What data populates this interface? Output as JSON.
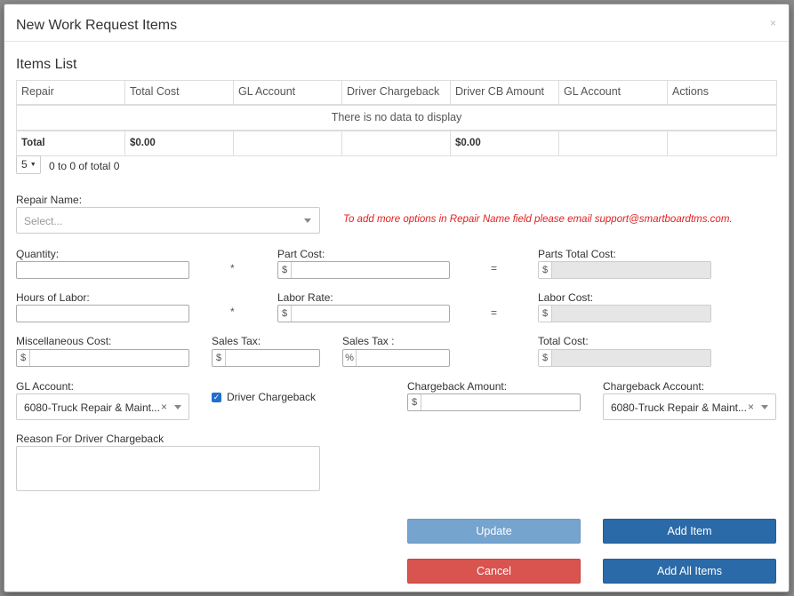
{
  "modal": {
    "title": "New Work Request Items",
    "close": "×",
    "section_title": "Items List"
  },
  "grid": {
    "columns": [
      "Repair",
      "Total Cost",
      "GL Account",
      "Driver Chargeback",
      "Driver CB Amount",
      "GL Account",
      "Actions"
    ],
    "empty_message": "There is no data to display",
    "footer": [
      "Total",
      "$0.00",
      "",
      "",
      "$0.00",
      "",
      ""
    ]
  },
  "pager": {
    "page_size": "5",
    "info": "0 to 0 of total 0"
  },
  "form": {
    "repair_name_label": "Repair Name:",
    "repair_name_placeholder": "Select...",
    "repair_hint": "To add more options in Repair Name field please email support@smartboardtms.com.",
    "quantity_label": "Quantity:",
    "part_cost_label": "Part Cost:",
    "parts_total_label": "Parts Total Cost:",
    "hours_label": "Hours of Labor:",
    "labor_rate_label": "Labor Rate:",
    "labor_cost_label": "Labor Cost:",
    "misc_label": "Miscellaneous Cost:",
    "sales_tax_label": "Sales Tax:",
    "sales_tax_pct_label": "Sales Tax :",
    "total_cost_label": "Total Cost:",
    "gl_account_label": "GL Account:",
    "gl_account_value": "6080-Truck Repair & Maint...",
    "driver_chargeback_label": "Driver Chargeback",
    "chargeback_amount_label": "Chargeback Amount:",
    "chargeback_account_label": "Chargeback Account:",
    "chargeback_account_value": "6080-Truck Repair & Maint...",
    "reason_label": "Reason For Driver Chargeback",
    "dollar": "$",
    "percent": "%",
    "times": "*",
    "equals": "="
  },
  "buttons": {
    "update": "Update",
    "add_item": "Add Item",
    "cancel": "Cancel",
    "add_all": "Add All Items"
  }
}
